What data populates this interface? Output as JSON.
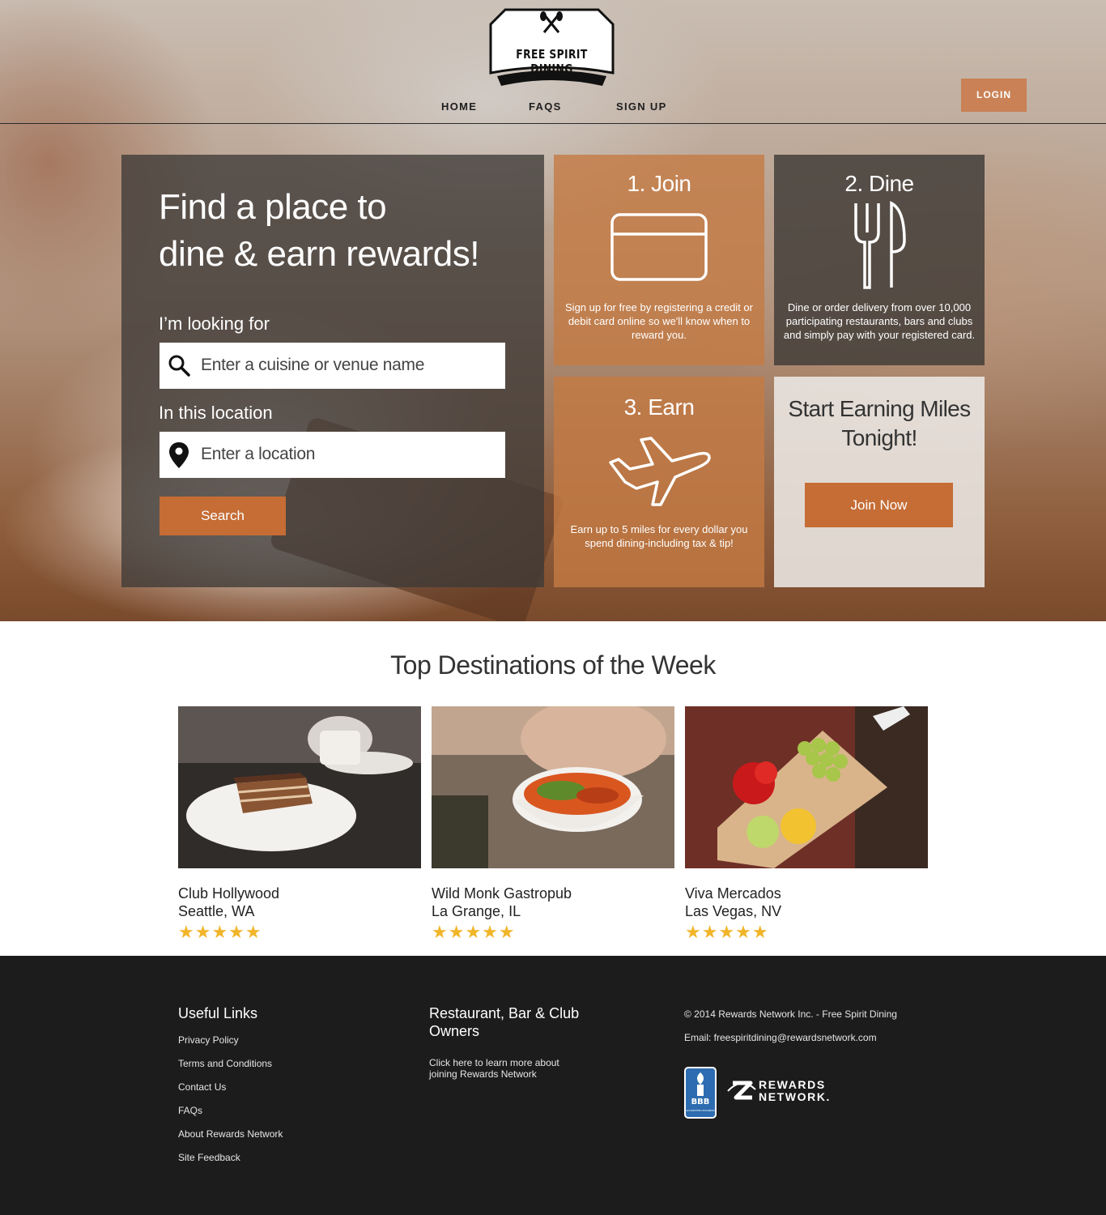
{
  "brand": {
    "name": "FREE SPIRIT DINING"
  },
  "nav": {
    "items": [
      "HOME",
      "FAQS",
      "SIGN UP"
    ],
    "login": "LOGIN"
  },
  "search": {
    "title_line1": "Find a place to",
    "title_line2": "dine & earn rewards!",
    "looking_label": "I’m looking for",
    "looking_placeholder": "Enter a cuisine or venue name",
    "location_label": "In this location",
    "location_placeholder": "Enter a location",
    "button": "Search"
  },
  "steps": [
    {
      "title": "1. Join",
      "icon": "credit-card-icon",
      "desc": "Sign up for free by registering a credit or debit card online so we'll know when to reward you."
    },
    {
      "title": "2. Dine",
      "icon": "fork-knife-icon",
      "desc": "Dine or order delivery from over 10,000 participating restaurants, bars and clubs and simply pay with your registered card."
    },
    {
      "title": "3. Earn",
      "icon": "airplane-icon",
      "desc": "Earn up to 5 miles for every dollar you spend dining-including tax & tip!"
    }
  ],
  "cta": {
    "title_line1": "Start Earning Miles",
    "title_line2": "Tonight!",
    "button": "Join Now"
  },
  "destinations": {
    "heading": "Top Destinations of the Week",
    "items": [
      {
        "name": "Club Hollywood",
        "location": "Seattle, WA",
        "stars": "★★★★★",
        "rating": 5
      },
      {
        "name": "Wild Monk Gastropub",
        "location": "La Grange, IL",
        "stars": "★★★★★",
        "rating": 5
      },
      {
        "name": "Viva Mercados",
        "location": "Las Vegas, NV",
        "stars": "★★★★★",
        "rating": 5
      }
    ]
  },
  "footer": {
    "useful_links_heading": "Useful Links",
    "links": [
      "Privacy Policy",
      "Terms and Conditions",
      "Contact Us",
      "FAQs",
      "About Rewards Network",
      "Site Feedback"
    ],
    "owners_heading_line1": "Restaurant, Bar & Club",
    "owners_heading_line2": "Owners",
    "owners_text_line1": "Click here to learn more about",
    "owners_text_line2": "joining Rewards Network",
    "copyright": "© 2014 Rewards Network Inc. - Free Spirit Dining",
    "email": "Email: freespiritdining@rewardsnetwork.com",
    "bbb_label": "BBB",
    "bbb_sub": "ACCREDITED BUSINESS",
    "rn_line1": "REWARDS",
    "rn_line2": "NETWORK."
  },
  "colors": {
    "accent": "#c56d35",
    "footer_bg": "#1c1c1c",
    "star": "#f1b52a"
  }
}
